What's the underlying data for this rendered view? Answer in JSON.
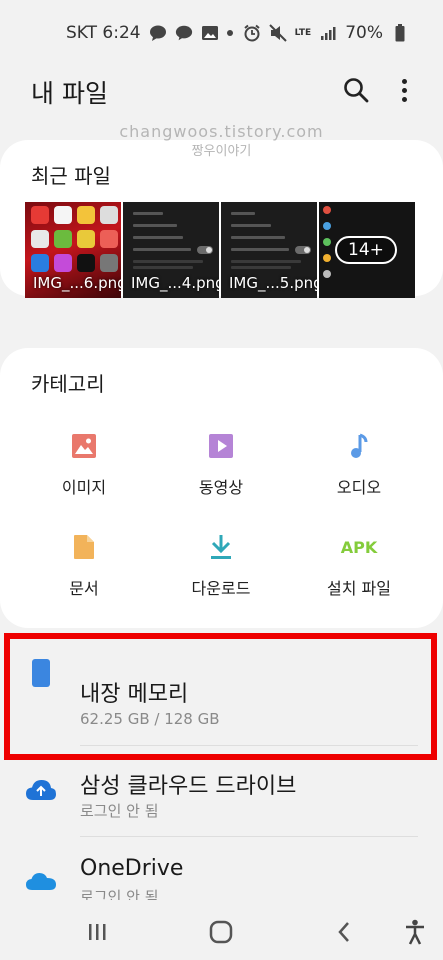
{
  "status_bar": {
    "carrier_time": "SKT 6:24",
    "network": "LTE",
    "battery": "70%"
  },
  "header": {
    "title": "내 파일",
    "search_icon": "search-icon",
    "more_icon": "more-vert-icon"
  },
  "watermark": {
    "line1": "changwoos.tistory.com",
    "line2": "짱우이야기"
  },
  "recent": {
    "title": "최근 파일",
    "items": [
      {
        "name": "IMG_...6.png"
      },
      {
        "name": "IMG_...4.png"
      },
      {
        "name": "IMG_...5.png"
      }
    ],
    "more_count": "14+"
  },
  "categories": {
    "title": "카테고리",
    "items": [
      {
        "label": "이미지",
        "icon": "image-icon",
        "color": "#e9786c"
      },
      {
        "label": "동영상",
        "icon": "video-icon",
        "color": "#b584d6"
      },
      {
        "label": "오디오",
        "icon": "music-icon",
        "color": "#5b9ae6"
      },
      {
        "label": "문서",
        "icon": "document-icon",
        "color": "#f2b35a"
      },
      {
        "label": "다운로드",
        "icon": "download-icon",
        "color": "#2fa8b8"
      },
      {
        "label": "설치 파일",
        "icon": "apk-icon",
        "color": "#84cc3b",
        "icon_text": "APK"
      }
    ]
  },
  "storage": {
    "items": [
      {
        "name": "내장 메모리",
        "sub": "62.25 GB / 128 GB",
        "icon": "phone-icon"
      },
      {
        "name": "삼성 클라우드 드라이브",
        "sub": "로그인 안 됨",
        "icon": "samsung-cloud-icon"
      },
      {
        "name": "OneDrive",
        "sub": "로그인 안 됨",
        "icon": "onedrive-icon"
      }
    ]
  },
  "colors": {
    "highlight": "#ee0000",
    "accent_blue": "#3b86e0"
  }
}
